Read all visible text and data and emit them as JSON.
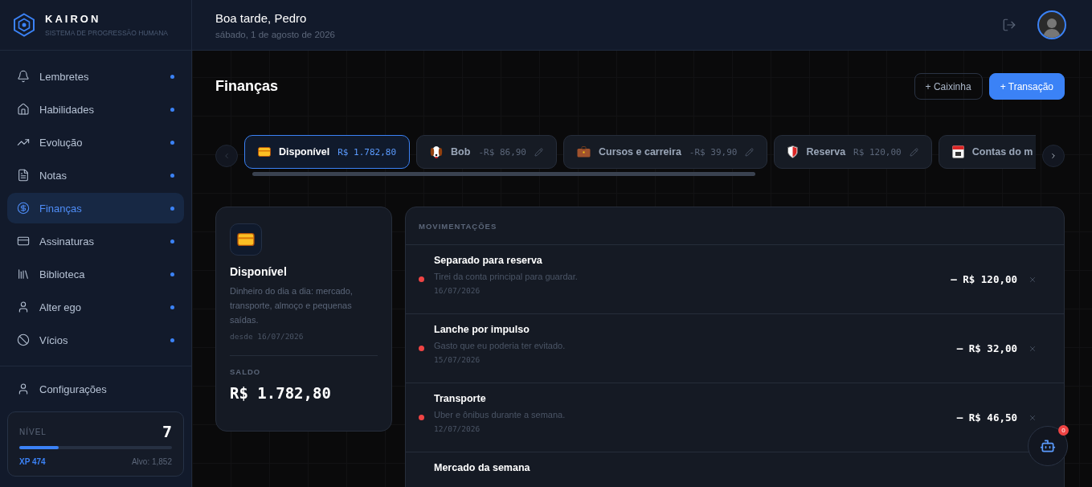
{
  "brand": {
    "name": "KAIRON",
    "tagline": "SISTEMA DE PROGRESSÃO HUMANA"
  },
  "header": {
    "greeting": "Boa tarde, Pedro",
    "date": "sábado, 1 de agosto de 2026"
  },
  "sidebar": {
    "items": [
      {
        "label": "Lembretes",
        "selected": false,
        "dot": true
      },
      {
        "label": "Habilidades",
        "selected": false,
        "dot": true
      },
      {
        "label": "Evolução",
        "selected": false,
        "dot": true
      },
      {
        "label": "Notas",
        "selected": false,
        "dot": true
      },
      {
        "label": "Finanças",
        "selected": true,
        "dot": true
      },
      {
        "label": "Assinaturas",
        "selected": false,
        "dot": true
      },
      {
        "label": "Biblioteca",
        "selected": false,
        "dot": true
      },
      {
        "label": "Alter ego",
        "selected": false,
        "dot": true
      },
      {
        "label": "Vícios",
        "selected": false,
        "dot": true
      }
    ],
    "settings": "Configurações",
    "level_card": {
      "label": "NÍVEL",
      "value": "7",
      "level": 0.26,
      "xp": "XP 474",
      "target": "Alvo: 1,852"
    }
  },
  "page": {
    "title": "Finanças",
    "buttons": [
      {
        "label": "+ Caixinha",
        "kind": "outline"
      },
      {
        "label": "+ Transação",
        "kind": "primary"
      }
    ]
  },
  "boxes": [
    {
      "name": "Disponível",
      "amount": "R$ 1.782,80",
      "selected": true,
      "editable": false
    },
    {
      "name": "Bob",
      "amount": "-R$ 86,90",
      "selected": false,
      "editable": true
    },
    {
      "name": "Cursos e carreira",
      "amount": "-R$ 39,90",
      "selected": false,
      "editable": true
    },
    {
      "name": "Reserva",
      "amount": "R$ 120,00",
      "selected": false,
      "editable": true
    },
    {
      "name": "Contas do m",
      "selected": false
    }
  ],
  "detail": {
    "name": "Disponível",
    "description": "Dinheiro do dia a dia: mercado, transporte, almoço e pequenas saídas.",
    "since": "desde 16/07/2026",
    "balance_label": "SALDO",
    "balance": "R$ 1.782,80"
  },
  "movements": {
    "title": "MOVIMENTAÇÕES",
    "items": [
      {
        "title": "Separado para reserva",
        "description": "Tirei da conta principal para guardar.",
        "date": "16/07/2026",
        "amount": "– R$ 120,00",
        "color": "#ef4444"
      },
      {
        "title": "Lanche por impulso",
        "description": "Gasto que eu poderia ter evitado.",
        "date": "15/07/2026",
        "amount": "– R$ 32,00",
        "color": "#ef4444"
      },
      {
        "title": "Transporte",
        "description": "Uber e ônibus durante a semana.",
        "date": "12/07/2026",
        "amount": "– R$ 46,50",
        "color": "#ef4444"
      },
      {
        "title": "Mercado da semana"
      }
    ]
  },
  "assistant": {
    "badge": "0"
  }
}
